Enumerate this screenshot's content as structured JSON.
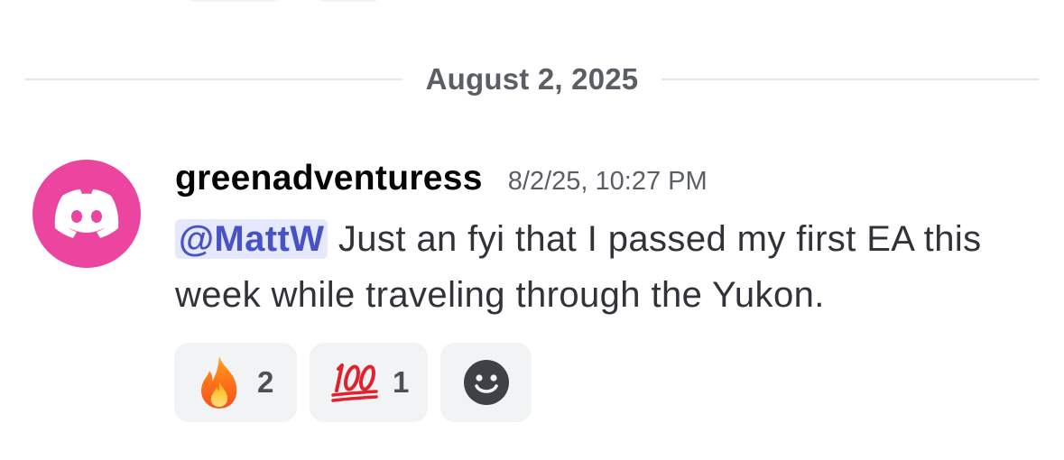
{
  "divider": {
    "date_label": "August 2, 2025"
  },
  "message": {
    "author": "greenadventuress",
    "timestamp": "8/2/25, 10:27 PM",
    "mention": "@MattW",
    "text": " Just an fyi that I passed my first EA this week while traveling  through the Yukon.",
    "avatar_color": "#eb459f"
  },
  "reactions": [
    {
      "emoji": "fire-emoji",
      "count": "2"
    },
    {
      "emoji": "hundred-points-emoji",
      "count": "1"
    }
  ],
  "add_reaction_icon": "smiley-face-icon",
  "colors": {
    "mention_bg": "#e6e8fd",
    "mention_text": "#4752c4",
    "reaction_bg": "#f2f3f5"
  }
}
